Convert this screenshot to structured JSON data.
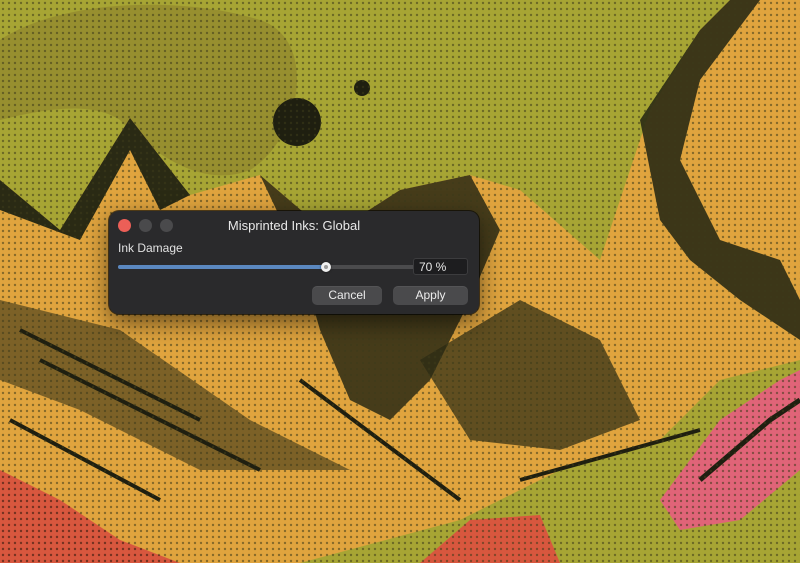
{
  "colors": {
    "background_yellow": "#a7a534",
    "background_orange": "#e0a43e",
    "ink_dark": "#2a2a14",
    "accent_red": "#d8573e",
    "accent_pink": "#e06478",
    "slider_fill": "#5b88c0",
    "close_light": "#ec5f57"
  },
  "window": {
    "title": "Misprinted Inks: Global",
    "controls": [
      "close-light-icon",
      "minimize-light-icon",
      "zoom-light-icon"
    ]
  },
  "ink_damage": {
    "label": "Ink Damage",
    "value_fraction": 0.7,
    "value_text": "70 %"
  },
  "buttons": {
    "cancel": "Cancel",
    "apply": "Apply"
  }
}
